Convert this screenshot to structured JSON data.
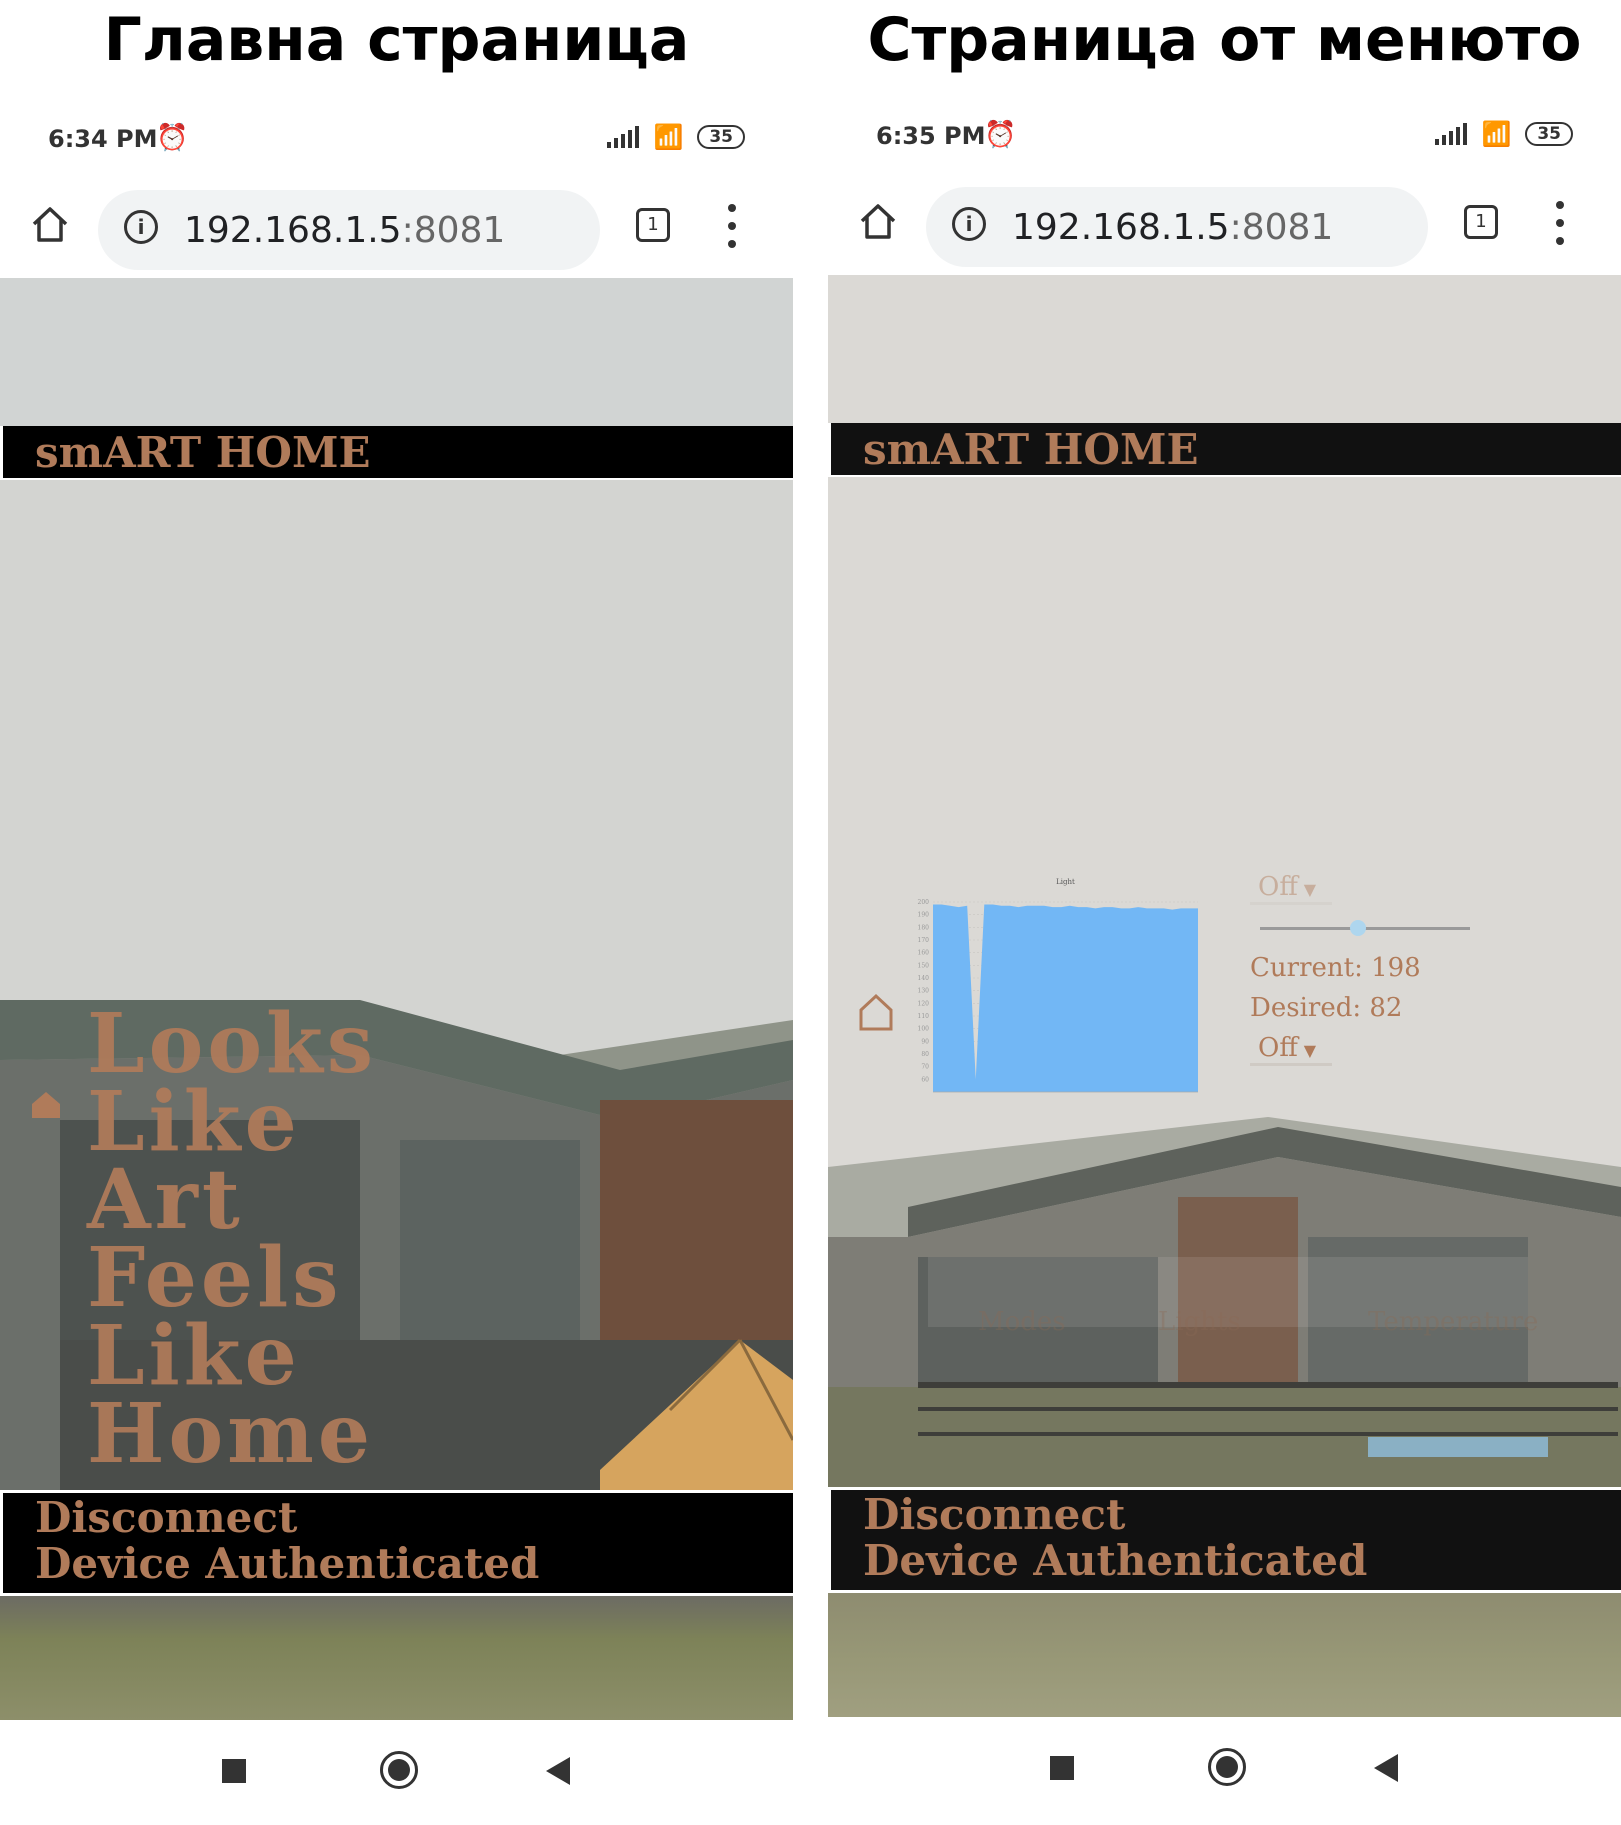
{
  "captions": {
    "left": "Главна страница",
    "right": "Страница от менюто"
  },
  "phones": [
    {
      "status_time": "6:34 PM",
      "battery": "35",
      "url_host": "192.168.1.5",
      "url_port": ":8081",
      "tab_count": "1"
    },
    {
      "status_time": "6:35 PM",
      "battery": "35",
      "url_host": "192.168.1.5",
      "url_port": ":8081",
      "tab_count": "1"
    }
  ],
  "app": {
    "brand": "smART HOME",
    "footer_line1": "Disconnect",
    "footer_line2": "Device Authenticated",
    "accent_color": "#b07b5a"
  },
  "main_page": {
    "slogan": [
      "Looks",
      "Like",
      "Art",
      "Feels",
      "Like",
      "Home"
    ]
  },
  "menu_page": {
    "select_top": "Off",
    "current": "Current: 198",
    "desired": "Desired: 82",
    "select_bottom": "Off",
    "slider_value": 0.6,
    "menu_items": [
      "Modes",
      "Lights",
      "Temperature"
    ]
  },
  "chart_data": {
    "type": "area",
    "title": "Light",
    "ylim": [
      50,
      200
    ],
    "y_ticks": [
      60,
      70,
      80,
      90,
      100,
      110,
      120,
      130,
      140,
      150,
      160,
      170,
      180,
      190,
      200
    ],
    "series": [
      {
        "values": [
          198,
          198,
          197,
          196,
          197,
          60,
          198,
          198,
          197,
          197,
          196,
          197,
          197,
          197,
          196,
          196,
          197,
          196,
          196,
          195,
          196,
          196,
          195,
          195,
          196,
          195,
          195,
          195,
          194,
          195,
          195,
          195
        ]
      }
    ],
    "color": "#72b7f5"
  }
}
